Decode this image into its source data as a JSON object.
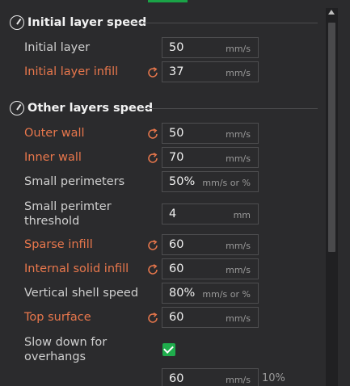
{
  "sections": {
    "initial": {
      "title": "Initial layer speed",
      "icon": "speedometer-icon"
    },
    "other": {
      "title": "Other layers speed",
      "icon": "speedometer-icon"
    }
  },
  "colors": {
    "modified_label": "#e8774c",
    "normal_label": "#cfcfcf",
    "accent": "#1aa347",
    "checkbox": "#1fad4c"
  },
  "settings": {
    "initial_layer": {
      "label": "Initial layer",
      "value": "50",
      "unit": "mm/s"
    },
    "initial_layer_infill": {
      "label": "Initial layer infill",
      "value": "37",
      "unit": "mm/s"
    },
    "outer_wall": {
      "label": "Outer wall",
      "value": "50",
      "unit": "mm/s"
    },
    "inner_wall": {
      "label": "Inner wall",
      "value": "70",
      "unit": "mm/s"
    },
    "small_perimeters": {
      "label": "Small perimeters",
      "value": "50%",
      "unit": "mm/s or %"
    },
    "small_perimeter_threshold": {
      "label_line1": "Small perimter",
      "label_line2": "threshold",
      "value": "4",
      "unit": "mm"
    },
    "sparse_infill": {
      "label": "Sparse infill",
      "value": "60",
      "unit": "mm/s"
    },
    "internal_solid_infill": {
      "label": "Internal solid infill",
      "value": "60",
      "unit": "mm/s"
    },
    "vertical_shell_speed": {
      "label": "Vertical shell speed",
      "value": "80%",
      "unit": "mm/s or %"
    },
    "top_surface": {
      "label": "Top surface",
      "value": "60",
      "unit": "mm/s"
    },
    "slow_down_overhangs": {
      "label_line1": "Slow down for",
      "label_line2": "overhangs",
      "checked": true
    },
    "overhang_speed": {
      "value": "60",
      "unit": "mm/s",
      "side_label": "10%"
    }
  }
}
